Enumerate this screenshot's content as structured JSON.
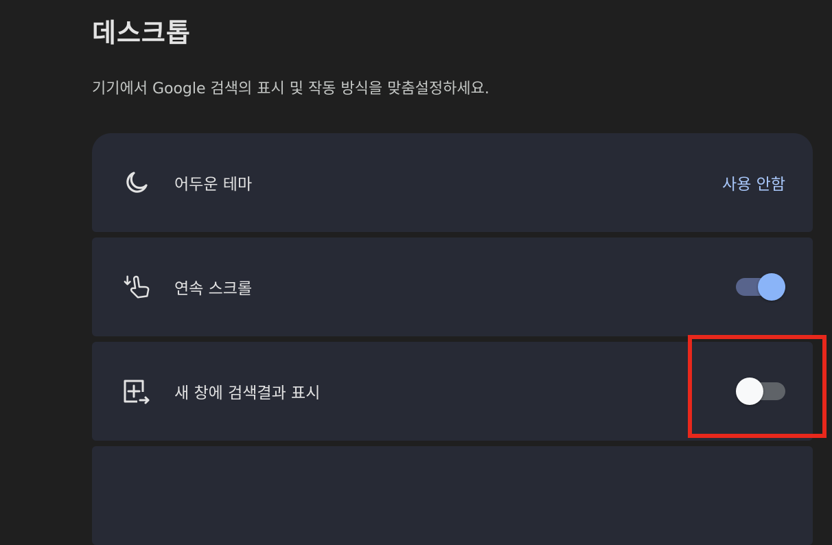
{
  "header": {
    "title": "데스크톱",
    "subtitle": "기기에서 Google 검색의 표시 및 작동 방식을 맞춤설정하세요."
  },
  "settings": [
    {
      "label": "어두운 테마",
      "icon": "moon-icon",
      "control": "link",
      "value": "사용 안함"
    },
    {
      "label": "연속 스크롤",
      "icon": "scroll-gesture-icon",
      "control": "toggle",
      "enabled": true
    },
    {
      "label": "새 창에 검색결과 표시",
      "icon": "open-in-new-window-icon",
      "control": "toggle",
      "enabled": false
    }
  ],
  "colors": {
    "background": "#1f1f1f",
    "card": "#272a35",
    "accent": "#a8c7fa",
    "toggle_on_thumb": "#8ab4f8",
    "highlight": "#e8281c"
  }
}
